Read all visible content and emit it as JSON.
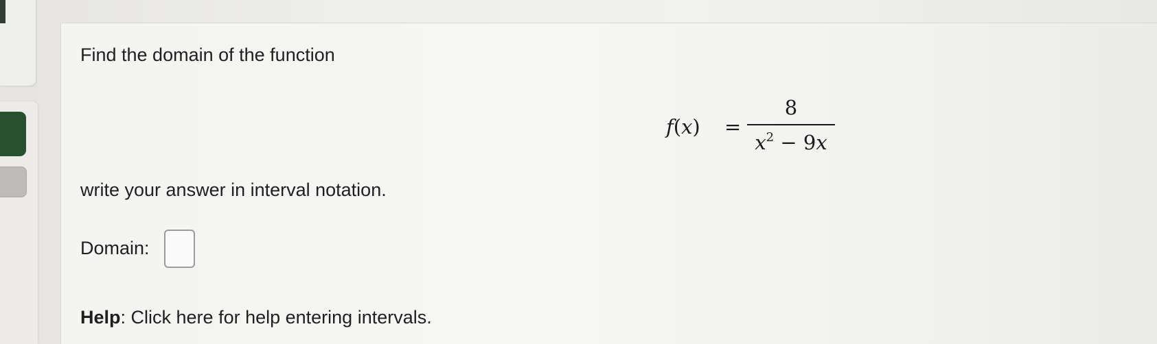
{
  "question": {
    "prompt": "Find the domain of the function",
    "formula": {
      "lhs_f": "f",
      "lhs_open": "(",
      "lhs_var": "x",
      "lhs_close": ")",
      "equals": "=",
      "numerator": "8",
      "den_var1": "x",
      "den_exp": "2",
      "den_op": " − 9",
      "den_var2": "x"
    },
    "instruction": "write your answer in interval notation.",
    "answer_label": "Domain:",
    "answer_value": ""
  },
  "help": {
    "label": "Help",
    "colon": ": ",
    "text": "Click here for help entering intervals."
  },
  "colors": {
    "nav_green": "#27502f",
    "nav_grey": "#bdbcba",
    "text": "#1f1f1f"
  }
}
